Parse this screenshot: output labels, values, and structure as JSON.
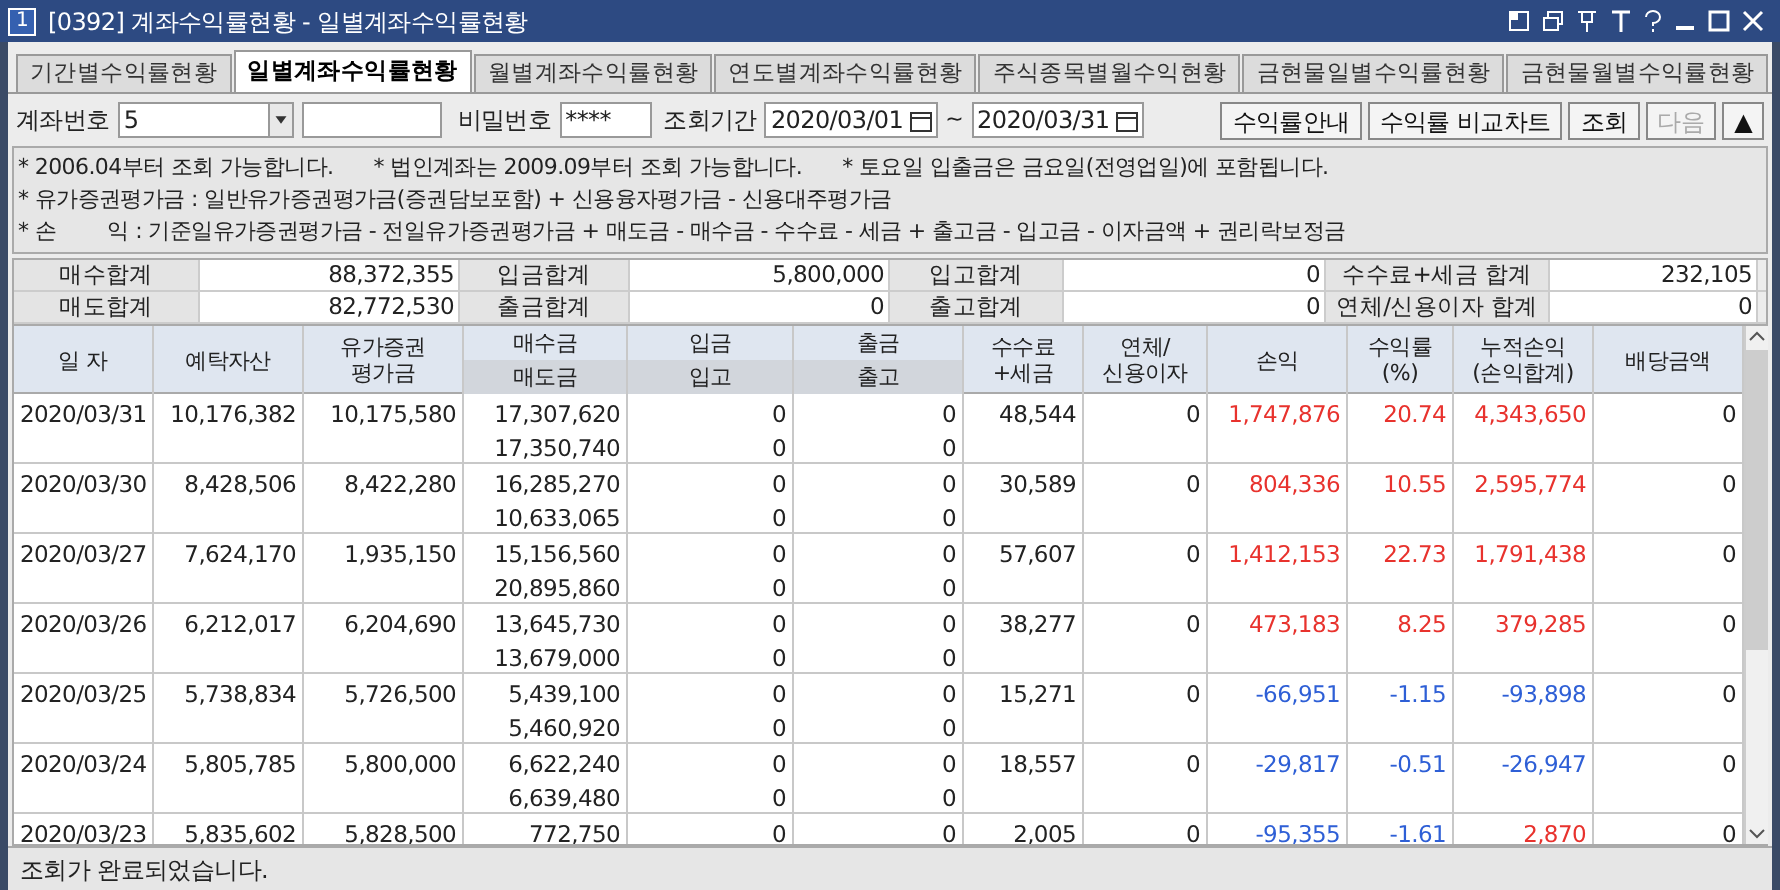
{
  "window": {
    "badge": "1",
    "title": "[0392] 계좌수익률현황 - 일별계좌수익률현황"
  },
  "tabs": [
    {
      "label": "기간별수익률현황",
      "selected": false
    },
    {
      "label": "일별계좌수익률현황",
      "selected": true
    },
    {
      "label": "월별계좌수익률현황",
      "selected": false
    },
    {
      "label": "연도별계좌수익률현황",
      "selected": false
    },
    {
      "label": "주식종목별월수익현황",
      "selected": false
    },
    {
      "label": "금현물일별수익률현황",
      "selected": false
    },
    {
      "label": "금현물월별수익률현황",
      "selected": false
    }
  ],
  "query": {
    "account_label": "계좌번호",
    "account_value": "5",
    "password_label": "비밀번호",
    "password_value": "****",
    "period_label": "조회기간",
    "date_from": "2020/03/01",
    "separator": "~",
    "date_to": "2020/03/31",
    "buttons": [
      {
        "label": "수익률안내",
        "disabled": false
      },
      {
        "label": "수익률 비교차트",
        "disabled": false
      },
      {
        "label": "조회",
        "disabled": false
      },
      {
        "label": "다음",
        "disabled": true
      },
      {
        "label": "▲",
        "disabled": false
      }
    ]
  },
  "notice": {
    "line_1": [
      "* 2006.04부터 조회 가능합니다.",
      "* 법인계좌는 2009.09부터 조회 가능합니다.",
      "* 토요일 입출금은 금요일(전영업일)에 포함됩니다."
    ],
    "line_2": "* 유가증권평가금 : 일반유가증권평가금(증권담보포함) + 신용융자평가금 - 신용대주평가금",
    "line_3": "* 손        익 : 기준일유가증권평가금 - 전일유가증권평가금 + 매도금 - 매수금 - 수수료 - 세금 + 출고금 - 입고금 - 이자금액 + 권리락보정금"
  },
  "summary": [
    [
      {
        "label": "매수합계",
        "value": "88,372,355"
      },
      {
        "label": "입금합계",
        "value": "5,800,000"
      },
      {
        "label": "입고합계",
        "value": "0"
      },
      {
        "label": "수수료+세금 합계",
        "value": "232,105"
      }
    ],
    [
      {
        "label": "매도합계",
        "value": "82,772,530"
      },
      {
        "label": "출금합계",
        "value": "0"
      },
      {
        "label": "출고합계",
        "value": "0"
      },
      {
        "label": "연체/신용이자 합계",
        "value": "0"
      }
    ]
  ],
  "table": {
    "columns": [
      {
        "top": [
          "일 자"
        ]
      },
      {
        "top": [
          "예탁자산"
        ]
      },
      {
        "top": [
          "유가증권",
          "평가금"
        ]
      },
      {
        "top": [
          "매수금"
        ],
        "bottom": "매도금"
      },
      {
        "top": [
          "입금"
        ],
        "bottom": "입고"
      },
      {
        "top": [
          "출금"
        ],
        "bottom": "출고"
      },
      {
        "top": [
          "수수료",
          "+세금"
        ]
      },
      {
        "top": [
          "연체/",
          "신용이자"
        ]
      },
      {
        "top": [
          "손익"
        ]
      },
      {
        "top": [
          "수익률",
          "(%)"
        ]
      },
      {
        "top": [
          "누적손익",
          "(손익합계)"
        ]
      },
      {
        "top": [
          "배당금액"
        ]
      }
    ],
    "rows": [
      {
        "date": "2020/03/31",
        "deposit_assets": "10,176,382",
        "securities": "10,175,580",
        "buy_sell": [
          "17,307,620",
          "17,350,740"
        ],
        "in": [
          "0",
          "0"
        ],
        "out": [
          "0",
          "0"
        ],
        "fee": "48,544",
        "interest": "0",
        "pnl": {
          "text": "1,747,876",
          "color": "#e8322d"
        },
        "rate": {
          "text": "20.74",
          "color": "#e8322d"
        },
        "cumulative": {
          "text": "4,343,650",
          "color": "#e8322d"
        },
        "dividend": "0"
      },
      {
        "date": "2020/03/30",
        "deposit_assets": "8,428,506",
        "securities": "8,422,280",
        "buy_sell": [
          "16,285,270",
          "10,633,065"
        ],
        "in": [
          "0",
          "0"
        ],
        "out": [
          "0",
          "0"
        ],
        "fee": "30,589",
        "interest": "0",
        "pnl": {
          "text": "804,336",
          "color": "#e8322d"
        },
        "rate": {
          "text": "10.55",
          "color": "#e8322d"
        },
        "cumulative": {
          "text": "2,595,774",
          "color": "#e8322d"
        },
        "dividend": "0"
      },
      {
        "date": "2020/03/27",
        "deposit_assets": "7,624,170",
        "securities": "1,935,150",
        "buy_sell": [
          "15,156,560",
          "20,895,860"
        ],
        "in": [
          "0",
          "0"
        ],
        "out": [
          "0",
          "0"
        ],
        "fee": "57,607",
        "interest": "0",
        "pnl": {
          "text": "1,412,153",
          "color": "#e8322d"
        },
        "rate": {
          "text": "22.73",
          "color": "#e8322d"
        },
        "cumulative": {
          "text": "1,791,438",
          "color": "#e8322d"
        },
        "dividend": "0"
      },
      {
        "date": "2020/03/26",
        "deposit_assets": "6,212,017",
        "securities": "6,204,690",
        "buy_sell": [
          "13,645,730",
          "13,679,000"
        ],
        "in": [
          "0",
          "0"
        ],
        "out": [
          "0",
          "0"
        ],
        "fee": "38,277",
        "interest": "0",
        "pnl": {
          "text": "473,183",
          "color": "#e8322d"
        },
        "rate": {
          "text": "8.25",
          "color": "#e8322d"
        },
        "cumulative": {
          "text": "379,285",
          "color": "#e8322d"
        },
        "dividend": "0"
      },
      {
        "date": "2020/03/25",
        "deposit_assets": "5,738,834",
        "securities": "5,726,500",
        "buy_sell": [
          "5,439,100",
          "5,460,920"
        ],
        "in": [
          "0",
          "0"
        ],
        "out": [
          "0",
          "0"
        ],
        "fee": "15,271",
        "interest": "0",
        "pnl": {
          "text": "-66,951",
          "color": "#2e5fd6"
        },
        "rate": {
          "text": "-1.15",
          "color": "#2e5fd6"
        },
        "cumulative": {
          "text": "-93,898",
          "color": "#2e5fd6"
        },
        "dividend": "0"
      },
      {
        "date": "2020/03/24",
        "deposit_assets": "5,805,785",
        "securities": "5,800,000",
        "buy_sell": [
          "6,622,240",
          "6,639,480"
        ],
        "in": [
          "0",
          "0"
        ],
        "out": [
          "0",
          "0"
        ],
        "fee": "18,557",
        "interest": "0",
        "pnl": {
          "text": "-29,817",
          "color": "#2e5fd6"
        },
        "rate": {
          "text": "-0.51",
          "color": "#2e5fd6"
        },
        "cumulative": {
          "text": "-26,947",
          "color": "#2e5fd6"
        },
        "dividend": "0"
      },
      {
        "date": "2020/03/23",
        "deposit_assets": "5,835,602",
        "securities": "5,828,500",
        "buy_sell": [
          "772,750"
        ],
        "in": [
          "0"
        ],
        "out": [
          "0"
        ],
        "fee": "2,005",
        "interest": "0",
        "pnl": {
          "text": "-95,355",
          "color": "#2e5fd6"
        },
        "rate": {
          "text": "-1.61",
          "color": "#2e5fd6"
        },
        "cumulative": {
          "text": "2,870",
          "color": "#e8322d"
        },
        "dividend": "0"
      }
    ]
  },
  "status_bar": "조회가 완료되었습니다."
}
